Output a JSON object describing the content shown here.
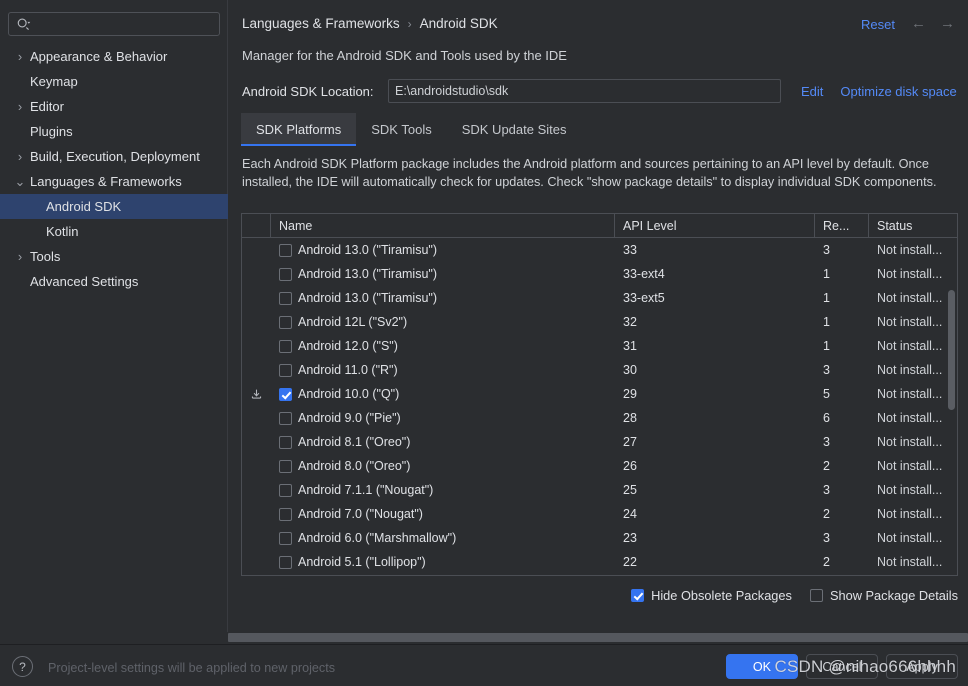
{
  "search": {
    "placeholder": "",
    "value": "",
    "icon": "search-icon"
  },
  "sidebar": {
    "items": [
      {
        "label": "Appearance & Behavior",
        "twisty": "›",
        "level": 0,
        "selected": false
      },
      {
        "label": "Keymap",
        "twisty": "",
        "level": 0,
        "selected": false
      },
      {
        "label": "Editor",
        "twisty": "›",
        "level": 0,
        "selected": false
      },
      {
        "label": "Plugins",
        "twisty": "",
        "level": 0,
        "selected": false
      },
      {
        "label": "Build, Execution, Deployment",
        "twisty": "›",
        "level": 0,
        "selected": false
      },
      {
        "label": "Languages & Frameworks",
        "twisty": "⌄",
        "level": 0,
        "selected": false
      },
      {
        "label": "Android SDK",
        "twisty": "",
        "level": 1,
        "selected": true
      },
      {
        "label": "Kotlin",
        "twisty": "",
        "level": 1,
        "selected": false
      },
      {
        "label": "Tools",
        "twisty": "›",
        "level": 0,
        "selected": false
      },
      {
        "label": "Advanced Settings",
        "twisty": "",
        "level": 0,
        "selected": false
      }
    ]
  },
  "header": {
    "breadcrumb_parent": "Languages & Frameworks",
    "breadcrumb_sep": "›",
    "breadcrumb_current": "Android SDK",
    "reset_label": "Reset",
    "back_arrow": "←",
    "forward_arrow": "→"
  },
  "main": {
    "subtitle": "Manager for the Android SDK and Tools used by the IDE",
    "sdk_location_label": "Android SDK Location:",
    "sdk_location_value": "E:\\androidstudio\\sdk",
    "sdk_location_placeholder": "",
    "edit_link": "Edit",
    "optimize_link": "Optimize disk space",
    "tabs": [
      {
        "label": "SDK Platforms",
        "active": true
      },
      {
        "label": "SDK Tools",
        "active": false
      },
      {
        "label": "SDK Update Sites",
        "active": false
      }
    ],
    "description": "Each Android SDK Platform package includes the Android platform and sources pertaining to an API level by default. Once installed, the IDE will automatically check for updates. Check \"show package details\" to display individual SDK components."
  },
  "table": {
    "columns": [
      "",
      "Name",
      "API Level",
      "Re...",
      "Status"
    ],
    "rows": [
      {
        "icon": "",
        "checked": false,
        "name": "Android 13.0 (\"Tiramisu\")",
        "api": "33",
        "rev": "3",
        "status": "Not install..."
      },
      {
        "icon": "",
        "checked": false,
        "name": "Android 13.0 (\"Tiramisu\")",
        "api": "33-ext4",
        "rev": "1",
        "status": "Not install..."
      },
      {
        "icon": "",
        "checked": false,
        "name": "Android 13.0 (\"Tiramisu\")",
        "api": "33-ext5",
        "rev": "1",
        "status": "Not install..."
      },
      {
        "icon": "",
        "checked": false,
        "name": "Android 12L (\"Sv2\")",
        "api": "32",
        "rev": "1",
        "status": "Not install..."
      },
      {
        "icon": "",
        "checked": false,
        "name": "Android 12.0 (\"S\")",
        "api": "31",
        "rev": "1",
        "status": "Not install..."
      },
      {
        "icon": "",
        "checked": false,
        "name": "Android 11.0 (\"R\")",
        "api": "30",
        "rev": "3",
        "status": "Not install..."
      },
      {
        "icon": "download-icon",
        "checked": true,
        "name": "Android 10.0 (\"Q\")",
        "api": "29",
        "rev": "5",
        "status": "Not install..."
      },
      {
        "icon": "",
        "checked": false,
        "name": "Android 9.0 (\"Pie\")",
        "api": "28",
        "rev": "6",
        "status": "Not install..."
      },
      {
        "icon": "",
        "checked": false,
        "name": "Android 8.1 (\"Oreo\")",
        "api": "27",
        "rev": "3",
        "status": "Not install..."
      },
      {
        "icon": "",
        "checked": false,
        "name": "Android 8.0 (\"Oreo\")",
        "api": "26",
        "rev": "2",
        "status": "Not install..."
      },
      {
        "icon": "",
        "checked": false,
        "name": "Android 7.1.1 (\"Nougat\")",
        "api": "25",
        "rev": "3",
        "status": "Not install..."
      },
      {
        "icon": "",
        "checked": false,
        "name": "Android 7.0 (\"Nougat\")",
        "api": "24",
        "rev": "2",
        "status": "Not install..."
      },
      {
        "icon": "",
        "checked": false,
        "name": "Android 6.0 (\"Marshmallow\")",
        "api": "23",
        "rev": "3",
        "status": "Not install..."
      },
      {
        "icon": "",
        "checked": false,
        "name": "Android 5.1 (\"Lollipop\")",
        "api": "22",
        "rev": "2",
        "status": "Not install..."
      }
    ]
  },
  "footer_options": [
    {
      "label": "Hide Obsolete Packages",
      "checked": true
    },
    {
      "label": "Show Package Details",
      "checked": false
    }
  ],
  "bottom": {
    "help_glyph": "?",
    "status_note": "Project-level settings will be applied to new projects",
    "buttons": [
      {
        "label": "OK",
        "primary": true
      },
      {
        "label": "Cancel",
        "primary": false
      },
      {
        "label": "Apply",
        "primary": false
      }
    ],
    "watermark": "CSDN @nihao666hhhh"
  },
  "colors": {
    "accent": "#3574f0",
    "link": "#548af7",
    "selection": "#2e436e",
    "background": "#2b2d30",
    "border": "#4b4e54"
  }
}
